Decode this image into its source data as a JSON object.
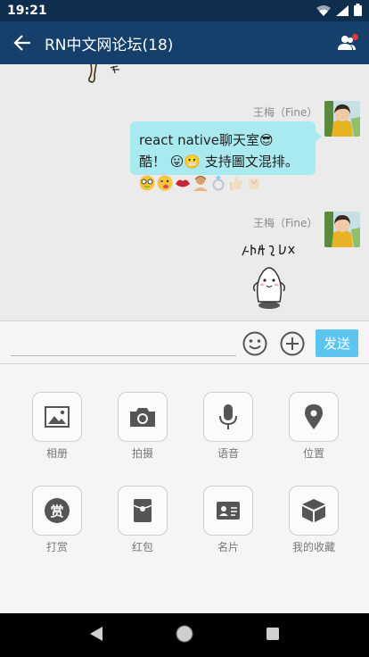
{
  "status_bar": {
    "time": "19:21"
  },
  "nav": {
    "title": "RN中文网论坛(18)"
  },
  "messages": [
    {
      "sender": "王梅（Fine）",
      "text_line1": "react native聊天室😎",
      "text_line2": "酷！ 😛😬 支持圖文混排。"
    },
    {
      "sender": "王梅（Fine）",
      "sticker_text": "好腻害哦"
    }
  ],
  "input": {
    "value": "",
    "placeholder": "",
    "send_label": "发送"
  },
  "panel": {
    "items": [
      {
        "label": "相册",
        "icon": "image-icon"
      },
      {
        "label": "拍摄",
        "icon": "camera-icon"
      },
      {
        "label": "语音",
        "icon": "microphone-icon"
      },
      {
        "label": "位置",
        "icon": "location-pin-icon"
      },
      {
        "label": "打赏",
        "icon": "reward-icon",
        "glyph": "赏"
      },
      {
        "label": "红包",
        "icon": "red-packet-icon"
      },
      {
        "label": "名片",
        "icon": "business-card-icon"
      },
      {
        "label": "我的收藏",
        "icon": "favorites-box-icon"
      }
    ]
  },
  "colors": {
    "status_bar": "#0f2d4c",
    "nav_bar": "#15406b",
    "bubble": "#a8eaf0",
    "send_button": "#5bc4f0",
    "badge": "#e53935"
  }
}
